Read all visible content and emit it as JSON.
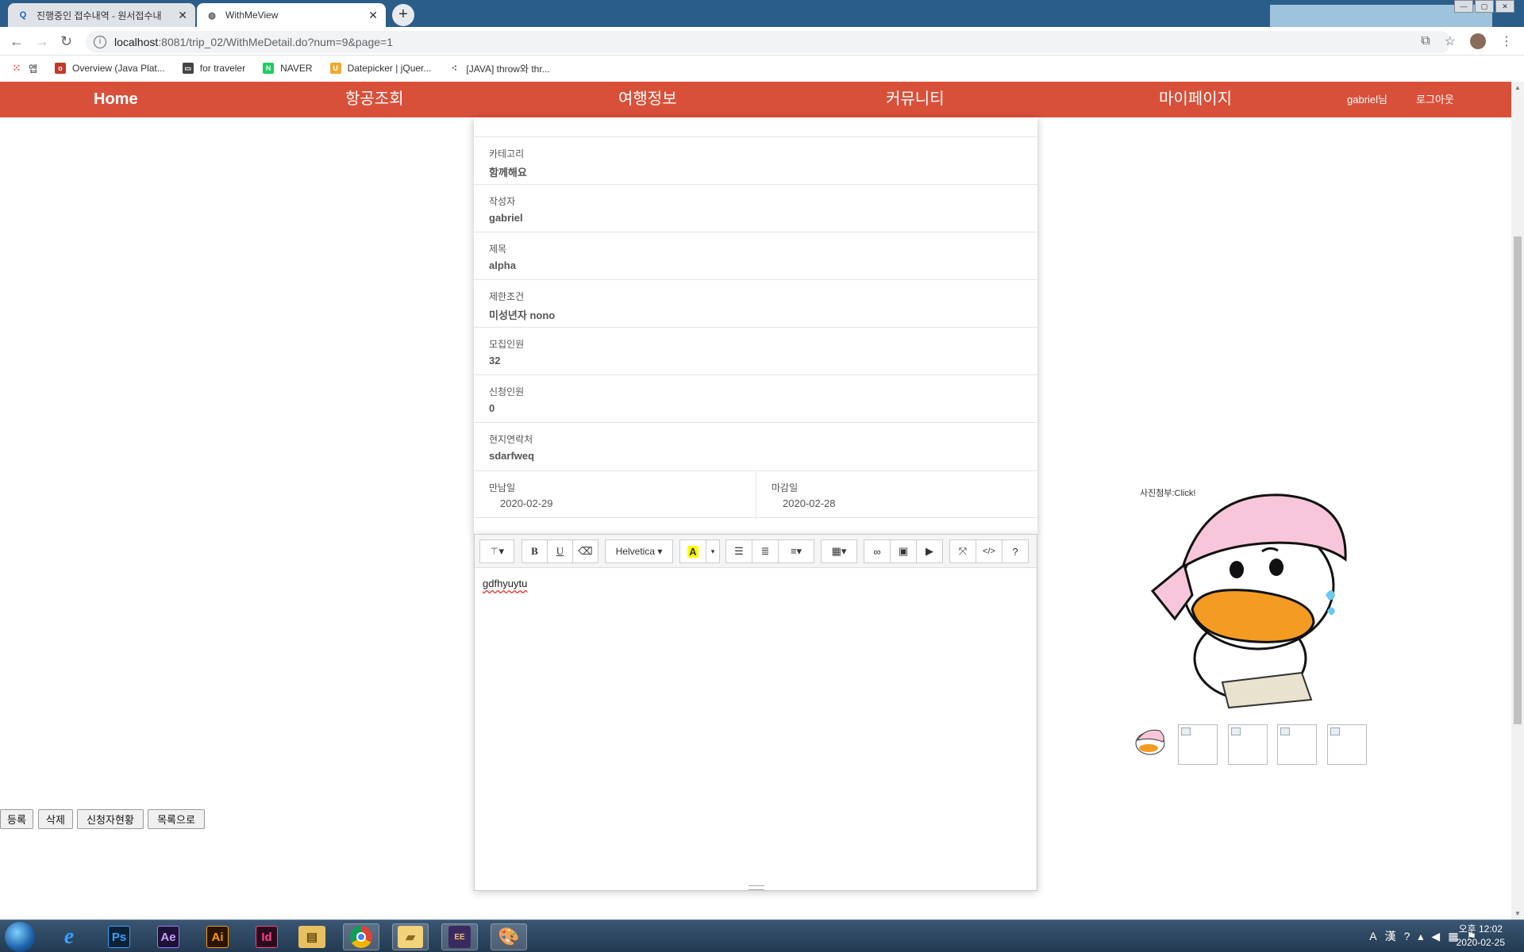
{
  "browser": {
    "tabs": [
      {
        "title": "진행중인 접수내역 - 원서접수내",
        "icon": "search-tab-icon"
      },
      {
        "title": "WithMeView",
        "icon": "globe-icon"
      }
    ],
    "url_host": "localhost",
    "url_path": ":8081/trip_02/WithMeDetail.do?num=9&page=1",
    "bookmarks": [
      {
        "label": "앱",
        "icon": "apps-grid-icon",
        "color": "#e8453c"
      },
      {
        "label": "Overview (Java Plat...",
        "icon": "oracle-icon",
        "color": "#c0392b"
      },
      {
        "label": "for traveler",
        "icon": "window-icon",
        "color": "#444444"
      },
      {
        "label": "NAVER",
        "icon": "naver-icon",
        "color": "#19ce60"
      },
      {
        "label": "Datepicker | jQuer...",
        "icon": "jquery-icon",
        "color": "#f0a830"
      },
      {
        "label": "[JAVA] throw와 thr...",
        "icon": "tistory-icon",
        "color": "#333333"
      }
    ]
  },
  "nav": {
    "home": "Home",
    "flight": "항공조회",
    "travel_info": "여행정보",
    "community": "커뮤니티",
    "mypage": "마이페이지",
    "user": "gabriel님",
    "logout": "로그아웃",
    "bg_color": "#d9503a"
  },
  "form": {
    "rows": [
      {
        "label": "카테고리",
        "value": "함께해요"
      },
      {
        "label": "작성자",
        "value": "gabriel"
      },
      {
        "label": "제목",
        "value": "alpha"
      },
      {
        "label": "제한조건",
        "value": "미성년자 nono"
      },
      {
        "label": "모집인원",
        "value": "32"
      },
      {
        "label": "신청인원",
        "value": "0"
      },
      {
        "label": "현지연락처",
        "value": "sdarfweq"
      }
    ],
    "meet_date_label": "만남일",
    "meet_date": "2020-02-29",
    "deadline_label": "마감일",
    "deadline": "2020-02-28"
  },
  "editor": {
    "font": "Helvetica",
    "content": "gdfhyuytu",
    "tools": {
      "bold": "B",
      "underline": "U",
      "color": "A",
      "help": "?"
    }
  },
  "buttons": {
    "register": "등록",
    "delete": "삭제",
    "applicants": "신청자현황",
    "list": "목록으로"
  },
  "image": {
    "caption": "사진첨부:Click!"
  },
  "taskbar": {
    "clock_time": "오후 12:02",
    "clock_date": "2020-02-25",
    "apps": [
      "ie-icon",
      "photoshop-icon",
      "after-effects-icon",
      "illustrator-icon",
      "indesign-icon",
      "file-explorer-icon",
      "chrome-icon",
      "folder-icon",
      "eclipse-icon",
      "paint-icon"
    ]
  }
}
